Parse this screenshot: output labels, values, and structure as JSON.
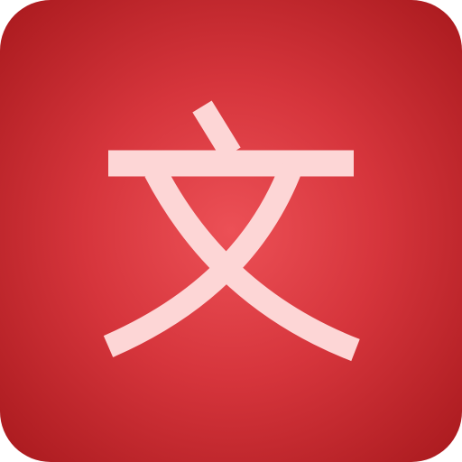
{
  "icon": {
    "glyph": "文",
    "glyph_name": "wen-character-icon",
    "background_color": "#d6353c",
    "background_edge_color": "#a8191d",
    "background_center_color": "#ec5056",
    "glyph_color": "#fdd6d6"
  }
}
